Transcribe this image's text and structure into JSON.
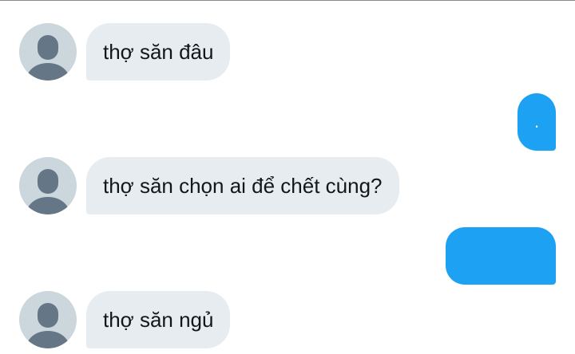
{
  "conversation": {
    "messages": [
      {
        "direction": "incoming",
        "text": "thợ săn đâu"
      },
      {
        "direction": "outgoing",
        "text": "."
      },
      {
        "direction": "incoming",
        "text": "thợ săn chọn ai để chết cùng?"
      },
      {
        "direction": "outgoing",
        "text": ""
      },
      {
        "direction": "incoming",
        "text": "thợ săn ngủ"
      }
    ]
  },
  "colors": {
    "incoming_bubble": "#e6ecf0",
    "outgoing_bubble": "#1da1f2",
    "avatar_bg": "#ccd6dd",
    "avatar_figure": "#657786"
  },
  "icons": {
    "avatar": "default-profile-icon"
  }
}
